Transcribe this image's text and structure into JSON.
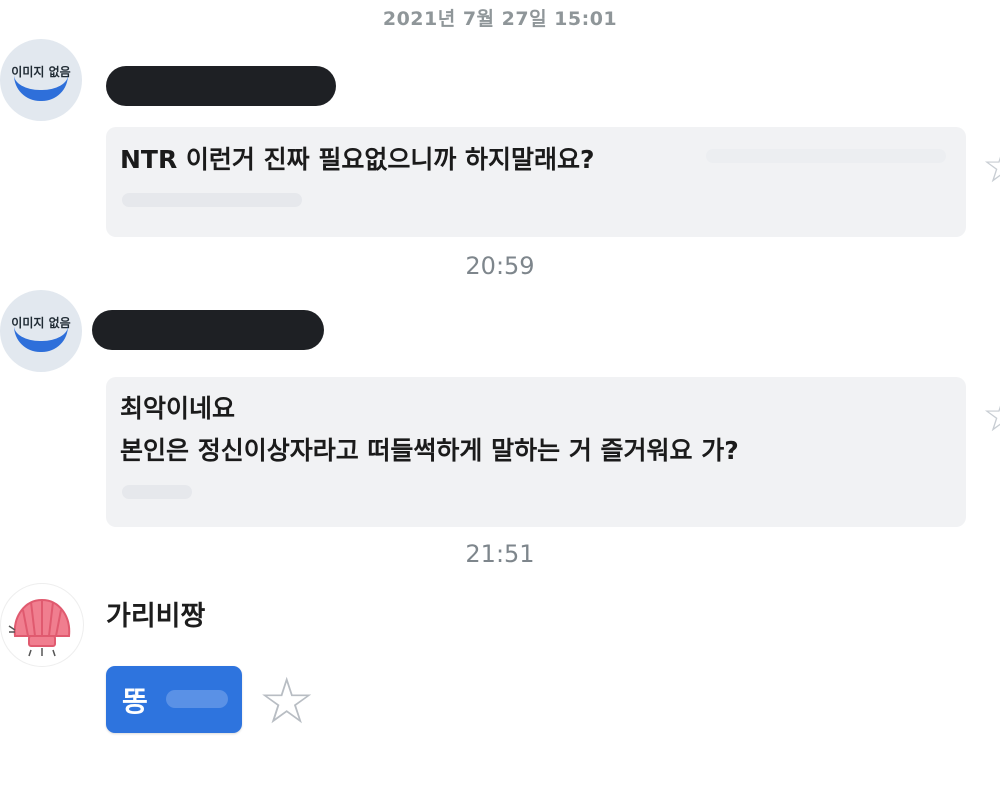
{
  "header": {
    "date": "2021년 7월 27일 15:01"
  },
  "messages": [
    {
      "avatar_text": "이미지 없음",
      "text_lines": [
        "NTR 이런거 진짜 필요없으니까 하지말래요?"
      ],
      "time": "20:59"
    },
    {
      "avatar_text": "이미지 없음",
      "text_lines": [
        "최악이네요",
        "본인은 정신이상자라고 떠들썩하게 말하는 거 즐거워요 가?"
      ],
      "time": "21:51"
    }
  ],
  "reply": {
    "sender": "가리비짱",
    "button_label": "똥"
  },
  "colors": {
    "accent_blue": "#2e74de",
    "bubble_bg": "#f1f2f4",
    "redaction": "#1e2024"
  },
  "icons": [
    "star-icon",
    "star-outline-icon",
    "shell-avatar-icon",
    "placeholder-avatar-icon"
  ]
}
